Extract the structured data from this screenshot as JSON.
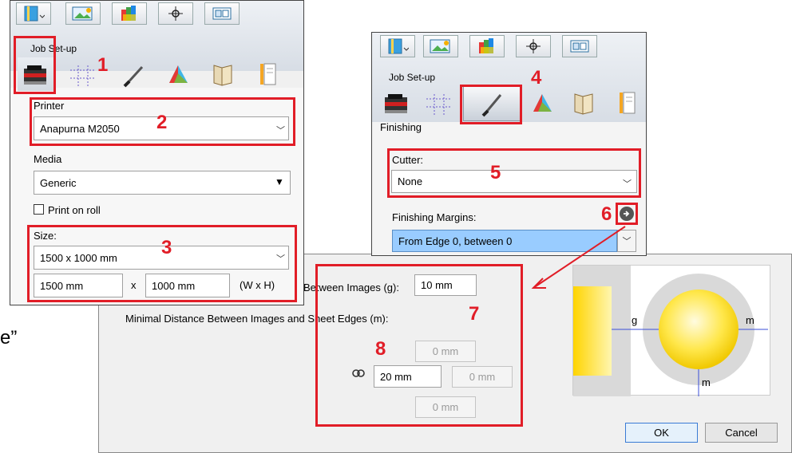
{
  "left_panel": {
    "job_setup_label": "Job Set-up",
    "printer_label": "Printer",
    "printer_value": "Anapurna M2050",
    "media_label": "Media",
    "media_value": "Generic",
    "print_on_roll_label": "Print on roll",
    "size_label": "Size:",
    "size_value": "1500 x 1000 mm",
    "width_value": "1500 mm",
    "x_sep": "x",
    "height_value": "1000 mm",
    "wxh_label": "(W x H)"
  },
  "right_panel": {
    "job_setup_label": "Job Set-up",
    "finishing_label": "Finishing",
    "cutter_label": "Cutter:",
    "cutter_value": "None",
    "finishing_margins_label": "Finishing Margins:",
    "finishing_margins_value": "From Edge 0, between 0"
  },
  "dialog": {
    "between_images_label": "Between Images (g):",
    "between_images_value": "10 mm",
    "min_distance_label": "Minimal Distance Between Images and Sheet Edges (m):",
    "top_value": "0 mm",
    "left_value": "20 mm",
    "right_value": "0 mm",
    "bottom_value": "0 mm",
    "ok_label": "OK",
    "cancel_label": "Cancel",
    "diagram_g": "g",
    "diagram_m_right": "m",
    "diagram_m_bottom": "m"
  },
  "annotations": [
    "1",
    "2",
    "3",
    "4",
    "5",
    "6",
    "7",
    "8"
  ],
  "cropped_text": "e”",
  "colors": {
    "annotation": "#e11d27",
    "selection": "#99ccff"
  }
}
